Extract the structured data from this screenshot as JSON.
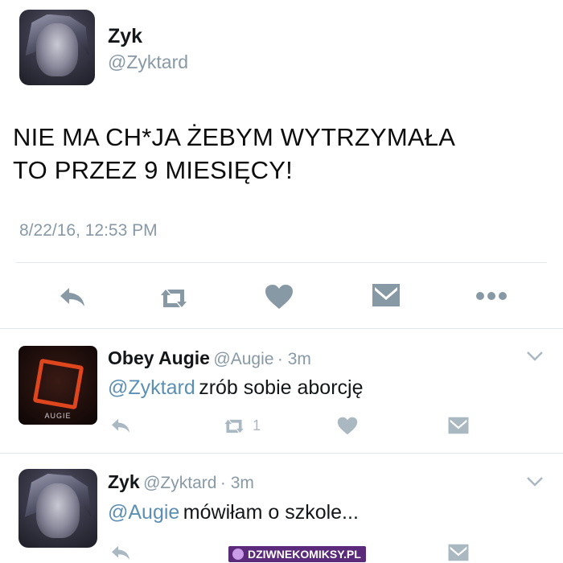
{
  "main_tweet": {
    "display_name": "Zyk",
    "handle": "@Zyktard",
    "text_line1": "NIE MA CH*JA ŻEBYM WYTRZYMAŁA",
    "text_line2": "TO PRZEZ 9 MIESIĘCY!",
    "timestamp": "8/22/16, 12:53 PM",
    "actions": [
      "reply-icon",
      "retweet-icon",
      "like-icon",
      "dm-icon",
      "more-icon"
    ]
  },
  "replies": [
    {
      "display_name": "Obey Augie",
      "handle": "@Augie",
      "time": "· 3m",
      "mention": "@Zyktard",
      "text": "zrób sobie aborcję",
      "retweet_count": "1",
      "avatar_text": "AUGIE"
    },
    {
      "display_name": "Zyk",
      "handle": "@Zyktard",
      "time": "· 3m",
      "mention": "@Augie",
      "text": "mówiłam o szkole..."
    }
  ],
  "watermark": "DZIWNEKOMIKSY.PL",
  "colors": {
    "icon_gray": "#aab8c2",
    "action_gray": "#8899a6",
    "mention_blue": "#5b8fb3"
  }
}
